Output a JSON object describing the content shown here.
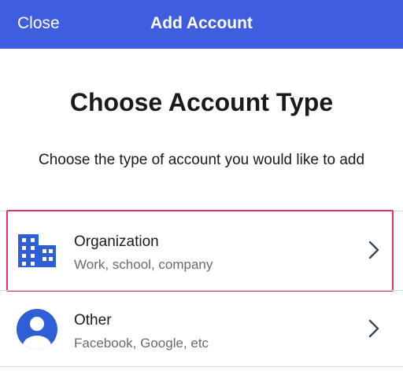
{
  "header": {
    "close_label": "Close",
    "title": "Add Account",
    "background_color": "#3e5ddf"
  },
  "main": {
    "title": "Choose Account Type",
    "subtitle": "Choose the type of account you would like to add"
  },
  "account_types": [
    {
      "label": "Organization",
      "sublabel": "Work, school, company",
      "icon": "building-icon",
      "highlighted": true
    },
    {
      "label": "Other",
      "sublabel": "Facebook, Google, etc",
      "icon": "person-avatar-icon",
      "highlighted": false
    }
  ],
  "colors": {
    "accent": "#2f5fd7",
    "highlight_border": "#e5306d"
  }
}
